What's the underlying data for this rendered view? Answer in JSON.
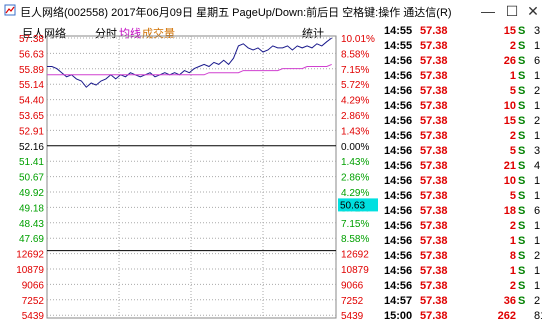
{
  "window": {
    "title": "巨人网络(002558) 2017年06月09日 星期五 PageUp/Down:前后日 空格键:操作 通达信(R)",
    "minimize": "—",
    "maximize": "☐",
    "close": "✕"
  },
  "toolbar": {
    "stock": "巨人网络",
    "tab_timeshare": "分时",
    "tab_avg": "均线",
    "tab_volume": "成交量",
    "stats": "统计"
  },
  "chart_data": {
    "type": "line",
    "title": "",
    "price_ticks": [
      "57.38",
      "56.63",
      "55.89",
      "55.14",
      "54.40",
      "53.65",
      "52.91",
      "52.16",
      "51.41",
      "50.67",
      "49.92",
      "49.18",
      "48.43",
      "47.69"
    ],
    "pct_ticks": [
      "10.01%",
      "8.58%",
      "7.15%",
      "5.72%",
      "4.29%",
      "2.86%",
      "1.43%",
      "0.00%",
      "1.43%",
      "2.86%",
      "4.29%",
      "5.72%",
      "7.15%",
      "8.58%"
    ],
    "pct_colors": [
      "#e00000",
      "#e00000",
      "#e00000",
      "#e00000",
      "#e00000",
      "#e00000",
      "#e00000",
      "#000000",
      "#00a000",
      "#00a000",
      "#00a000",
      "#00a000",
      "#00a000",
      "#00a000"
    ],
    "volume_ticks": [
      "12692",
      "10879",
      "9066",
      "7252",
      "5439"
    ],
    "current_price_label": "50.63",
    "ylim": [
      47.69,
      57.38
    ],
    "series": [
      {
        "values": [
          56.0,
          56.0,
          55.9,
          55.7,
          55.5,
          55.6,
          55.4,
          55.3,
          55.0,
          55.2,
          55.1,
          55.3,
          55.4,
          55.6,
          55.4,
          55.6,
          55.5,
          55.7,
          55.6,
          55.5,
          55.6,
          55.7,
          55.5,
          55.6,
          55.7,
          55.6,
          55.7,
          55.6,
          55.8,
          55.7,
          55.9,
          56.0,
          56.1,
          56.0,
          56.2,
          56.1,
          56.3,
          56.1,
          56.4,
          57.0,
          57.1,
          56.9,
          56.8,
          56.9,
          56.7,
          56.8,
          57.0,
          56.9,
          56.9,
          57.0,
          56.8,
          57.0,
          56.9,
          57.0,
          56.9,
          57.1,
          57.0,
          57.2,
          57.38
        ]
      },
      {
        "values": [
          55.6,
          55.6,
          55.6,
          55.6,
          55.6,
          55.6,
          55.6,
          55.6,
          55.6,
          55.6,
          55.6,
          55.6,
          55.6,
          55.6,
          55.6,
          55.6,
          55.6,
          55.6,
          55.6,
          55.6,
          55.6,
          55.6,
          55.6,
          55.6,
          55.6,
          55.6,
          55.6,
          55.6,
          55.6,
          55.6,
          55.6,
          55.6,
          55.6,
          55.7,
          55.7,
          55.7,
          55.7,
          55.7,
          55.7,
          55.7,
          55.8,
          55.8,
          55.8,
          55.8,
          55.8,
          55.8,
          55.8,
          55.8,
          55.9,
          55.9,
          55.9,
          55.9,
          55.9,
          56.0,
          56.0,
          56.0,
          56.0,
          56.0,
          56.1
        ]
      }
    ]
  },
  "ticks": [
    {
      "time": "14:55",
      "price": "57.38",
      "vol": "15",
      "dir": "S",
      "num": "3"
    },
    {
      "time": "14:55",
      "price": "57.38",
      "vol": "2",
      "dir": "S",
      "num": "1"
    },
    {
      "time": "14:56",
      "price": "57.38",
      "vol": "26",
      "dir": "S",
      "num": "6"
    },
    {
      "time": "14:56",
      "price": "57.38",
      "vol": "1",
      "dir": "S",
      "num": "1"
    },
    {
      "time": "14:56",
      "price": "57.38",
      "vol": "5",
      "dir": "S",
      "num": "2"
    },
    {
      "time": "14:56",
      "price": "57.38",
      "vol": "10",
      "dir": "S",
      "num": "1"
    },
    {
      "time": "14:56",
      "price": "57.38",
      "vol": "15",
      "dir": "S",
      "num": "2"
    },
    {
      "time": "14:56",
      "price": "57.38",
      "vol": "2",
      "dir": "S",
      "num": "1"
    },
    {
      "time": "14:56",
      "price": "57.38",
      "vol": "5",
      "dir": "S",
      "num": "3"
    },
    {
      "time": "14:56",
      "price": "57.38",
      "vol": "21",
      "dir": "S",
      "num": "4"
    },
    {
      "time": "14:56",
      "price": "57.38",
      "vol": "10",
      "dir": "S",
      "num": "1"
    },
    {
      "time": "14:56",
      "price": "57.38",
      "vol": "5",
      "dir": "S",
      "num": "1"
    },
    {
      "time": "14:56",
      "price": "57.38",
      "vol": "18",
      "dir": "S",
      "num": "6"
    },
    {
      "time": "14:56",
      "price": "57.38",
      "vol": "2",
      "dir": "S",
      "num": "1"
    },
    {
      "time": "14:56",
      "price": "57.38",
      "vol": "1",
      "dir": "S",
      "num": "1"
    },
    {
      "time": "14:56",
      "price": "57.38",
      "vol": "8",
      "dir": "S",
      "num": "2"
    },
    {
      "time": "14:56",
      "price": "57.38",
      "vol": "1",
      "dir": "S",
      "num": "1"
    },
    {
      "time": "14:56",
      "price": "57.38",
      "vol": "2",
      "dir": "S",
      "num": "1"
    },
    {
      "time": "14:57",
      "price": "57.38",
      "vol": "36",
      "dir": "S",
      "num": "2"
    },
    {
      "time": "15:00",
      "price": "57.38",
      "vol": "262",
      "dir": "",
      "num": "81"
    }
  ]
}
